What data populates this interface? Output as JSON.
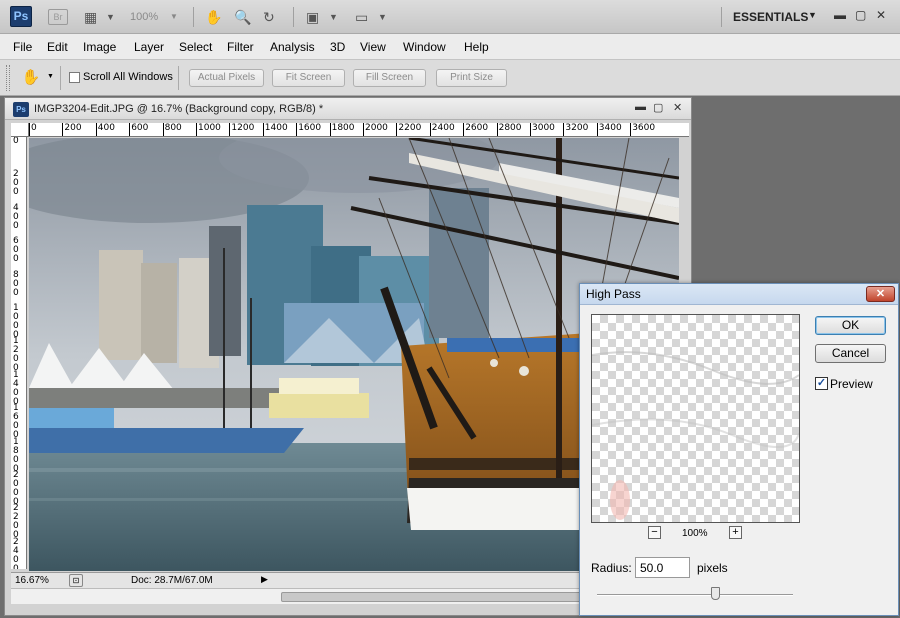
{
  "appbar": {
    "logo": "Ps",
    "bridge": "Br",
    "zoom": "100%",
    "workspace": "ESSENTIALS",
    "icons": [
      "film-icon",
      "hand-icon",
      "zoom-icon",
      "rotate-icon",
      "arrange-icon",
      "screen-mode-icon"
    ]
  },
  "menu": [
    "File",
    "Edit",
    "Image",
    "Layer",
    "Select",
    "Filter",
    "Analysis",
    "3D",
    "View",
    "Window",
    "Help"
  ],
  "options": {
    "scroll_all": "Scroll All Windows",
    "buttons": [
      "Actual Pixels",
      "Fit Screen",
      "Fill Screen",
      "Print Size"
    ]
  },
  "document": {
    "icon": "Ps",
    "title": "IMGP3204-Edit.JPG @ 16.7% (Background copy, RGB/8) *",
    "ruler_top": [
      "0",
      "200",
      "400",
      "600",
      "800",
      "1000",
      "1200",
      "1400",
      "1600",
      "1800",
      "2000",
      "2200",
      "2400",
      "2600",
      "2800",
      "3000",
      "3200",
      "3400",
      "3600"
    ],
    "ruler_left": [
      "0",
      "2\n0\n0",
      "4\n0\n0",
      "6\n0\n0",
      "8\n0\n0",
      "1\n0\n0\n0",
      "1\n2\n0\n0",
      "1\n4\n0\n0",
      "1\n6\n0\n0",
      "1\n8\n0\n0",
      "2\n0\n0\n0",
      "2\n2\n0\n0",
      "2\n4\n0\n0"
    ],
    "status_zoom": "16.67%",
    "doc_info": "Doc: 28.7M/67.0M"
  },
  "dialog": {
    "title": "High Pass",
    "ok": "OK",
    "cancel": "Cancel",
    "preview_label": "Preview",
    "preview_checked": "✓",
    "zoom_minus": "−",
    "zoom_plus": "+",
    "zoom_pct": "100%",
    "radius_label": "Radius:",
    "radius_value": "50.0",
    "radius_unit": "pixels",
    "radius_slider_fraction": 0.6
  }
}
